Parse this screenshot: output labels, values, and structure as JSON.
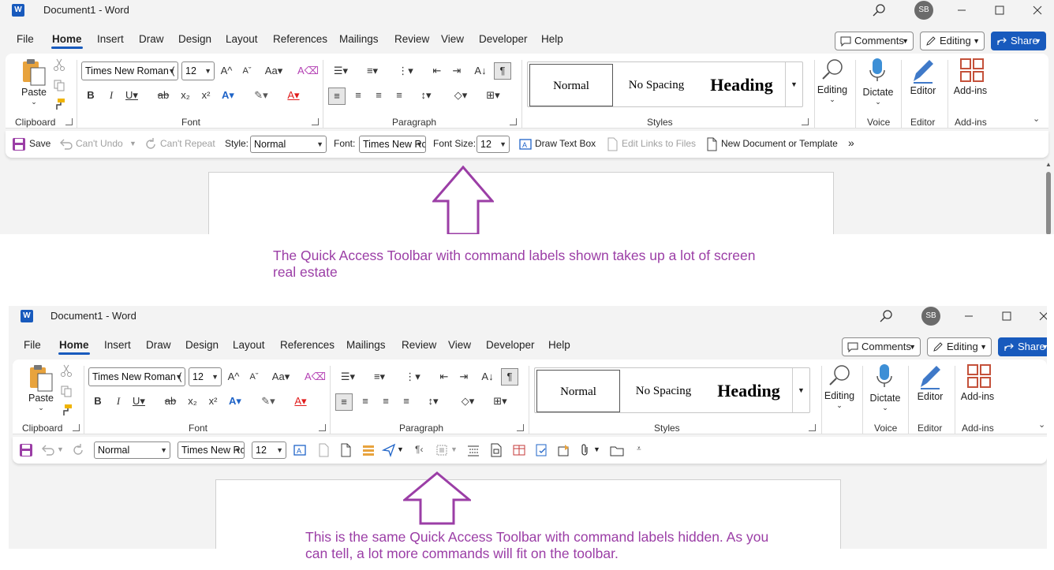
{
  "word": {
    "logo": "W",
    "doc_title": "Document1  -  Word",
    "avatar": "SB",
    "menu": [
      "File",
      "Home",
      "Insert",
      "Draw",
      "Design",
      "Layout",
      "References",
      "Mailings",
      "Review",
      "View",
      "Developer",
      "Help"
    ],
    "comments_label": "Comments",
    "editing_label": "Editing",
    "share_label": "Share",
    "ribbon": {
      "paste_label": "Paste",
      "font_name": "Times New Roman (",
      "font_size": "12",
      "groups": {
        "clipboard": "Clipboard",
        "font": "Font",
        "paragraph": "Paragraph",
        "styles": "Styles",
        "voice": "Voice",
        "editor": "Editor",
        "addins": "Add-ins"
      },
      "styles": {
        "normal": "Normal",
        "no_spacing": "No Spacing",
        "heading": "Heading"
      },
      "editing_btn": "Editing",
      "dictate_btn": "Dictate",
      "editor_btn": "Editor",
      "addins_btn": "Add-ins",
      "change_case": "Aa"
    }
  },
  "qat_labeled": {
    "save": "Save",
    "undo": "Can't Undo",
    "repeat": "Can't Repeat",
    "style_label": "Style:",
    "style_value": "Normal",
    "font_label": "Font:",
    "font_value": "Times New Ro",
    "size_label": "Font Size:",
    "size_value": "12",
    "draw_text_box": "Draw Text Box",
    "edit_links": "Edit Links to Files",
    "new_doc": "New Document or Template",
    "more": "»"
  },
  "qat_compact": {
    "style_value": "Normal",
    "font_value": "Times New Ro",
    "size_value": "12"
  },
  "captions": {
    "top": "The Quick Access Toolbar with command labels shown takes up a lot of screen real estate",
    "bottom": "This is the same Quick Access Toolbar with command labels hidden. As you can tell, a lot more commands will fit on the toolbar."
  },
  "colors": {
    "accent": "#185abd",
    "caption": "#9b3ea6",
    "arrow": "#9b3ea6",
    "font_color_red": "#e01b1b"
  }
}
